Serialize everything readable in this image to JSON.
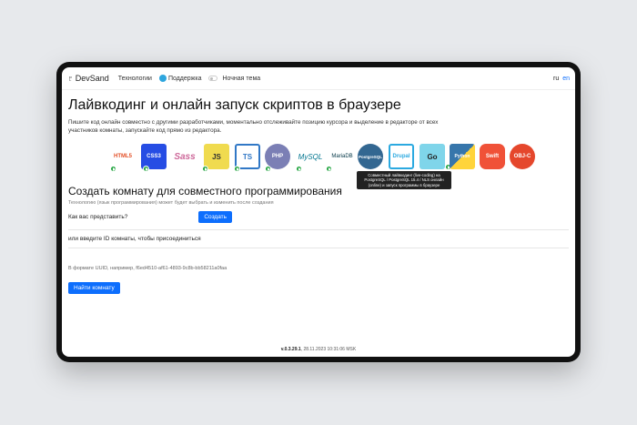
{
  "navbar": {
    "brand": "DevSand",
    "links": [
      "Технологии",
      "Поддержка",
      "Ночная тема"
    ],
    "lang_current": "ru",
    "lang_alt": "en"
  },
  "main": {
    "title": "Лайвкодинг и онлайн запуск скриптов в браузере",
    "lead": "Пишите код онлайн совместно с другими разработчиками, моментально отслеживайте позицию курсора и выделение в редакторе от всех участников комнаты, запускайте код прямо из редактора.",
    "languages": [
      "HTML5",
      "CSS3",
      "Sass",
      "JS",
      "TS",
      "PHP",
      "MySQL",
      "MariaDB",
      "PostgreSQL",
      "Drupal",
      "Go",
      "Python",
      "Swift",
      "OBJ-C"
    ],
    "tooltip": "Совместный лайвкодинг (live-coding) на PostgreSQL / PostgreSQL 15.4 / NLS онлайн (online) и запуск программы в браузере",
    "create_title": "Создать комнату для совместного программирования",
    "create_hint": "Технологию (язык программирования) может будет выбрать и изменить после создания",
    "name_label": "Как вас представить?",
    "create_button": "Создать",
    "join_text": "или введите ID комнаты, чтобы присоединиться",
    "uuid_hint": "В формате UUID, например, f6ed4510-af61-4893-9c8b-bb58211a0faa",
    "find_button": "Найти комнату"
  },
  "footer": {
    "version": "v.0.3.29.1",
    "timestamp": ", 28.11.2023 10:31:06 MSK"
  },
  "colors": {
    "primary": "#0d6efd",
    "run": "#28a745"
  }
}
